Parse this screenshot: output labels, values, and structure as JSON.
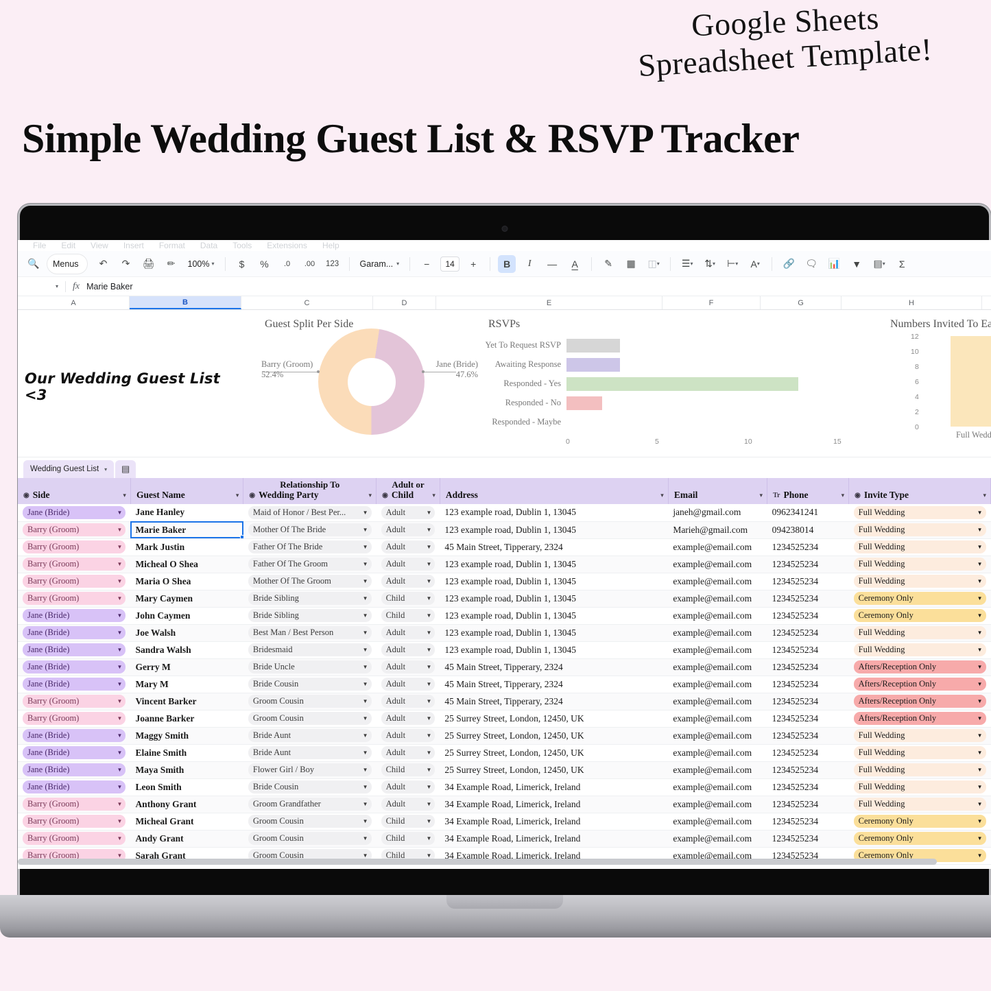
{
  "promo": {
    "badge_line1": "Google Sheets",
    "badge_line2": "Spreadsheet Template!",
    "title": "Simple Wedding Guest List & RSVP Tracker",
    "background_color": "#fbeef5"
  },
  "menubar": [
    "File",
    "Edit",
    "View",
    "Insert",
    "Format",
    "Data",
    "Tools",
    "Extensions",
    "Help"
  ],
  "toolbar": {
    "menus_label": "Menus",
    "search_icon": "search-icon",
    "undo_icon": "undo-icon",
    "redo_icon": "redo-icon",
    "print_icon": "print-icon",
    "paint_format_icon": "paint-format-icon",
    "zoom_value": "100%",
    "currency_label": "$",
    "percent_label": "%",
    "decrease_decimal_label": ".0",
    "increase_decimal_label": ".00",
    "number_format_label": "123",
    "font_name": "Garam...",
    "font_size": "14",
    "decrease_font_label": "−",
    "increase_font_label": "+",
    "bold_label": "B",
    "italic_label": "I",
    "strikethrough_label": "S",
    "text_color_label": "A",
    "fill_color_icon": "fill-color-icon",
    "borders_icon": "borders-icon",
    "merge_icon": "merge-cells-icon",
    "halign_icon": "horizontal-align-icon",
    "valign_icon": "vertical-align-icon",
    "wrap_icon": "text-wrap-icon",
    "rotate_icon": "text-rotation-icon",
    "link_icon": "insert-link-icon",
    "comment_icon": "insert-comment-icon",
    "chart_icon": "insert-chart-icon",
    "filter_icon": "create-filter-icon",
    "functions_icon": "functions-icon",
    "sigma_label": "Σ"
  },
  "formula_bar": {
    "name_box_caret": "name-box-caret",
    "fx_label": "fx",
    "value": "Marie Baker"
  },
  "column_letters": [
    "A",
    "B",
    "C",
    "D",
    "E",
    "F",
    "G",
    "H"
  ],
  "selected_column": "B",
  "sheet_tab": {
    "name": "Wedding Guest List",
    "caret_icon": "chevron-down-icon",
    "all_sheets_icon": "all-sheets-icon"
  },
  "hand_title": "Our Wedding Guest List <3",
  "chart_data": [
    {
      "type": "pie",
      "title": "Guest Split Per Side",
      "labels": [
        "Barry (Groom)",
        "Jane (Bride)"
      ],
      "values": [
        52.4,
        47.6
      ],
      "value_labels": [
        "52.4%",
        "47.6%"
      ],
      "colors": [
        "#fbdcb9",
        "#e3c4d8"
      ],
      "donut": true,
      "legend": "callout-labels"
    },
    {
      "type": "bar",
      "orientation": "horizontal",
      "title": "RSVPs",
      "categories": [
        "Yet To Request RSVP",
        "Awaiting Response",
        "Responded - Yes",
        "Responded - No",
        "Responded - Maybe"
      ],
      "values": [
        3,
        3,
        13,
        2,
        0
      ],
      "colors": [
        "#d6d6d6",
        "#cdc6e8",
        "#cde3c4",
        "#f3bfc0",
        "#ffffff"
      ],
      "xlabel": "",
      "ylabel": "",
      "xlim": [
        0,
        15
      ],
      "xticks": [
        "0",
        "5",
        "10",
        "15"
      ],
      "grid": false
    },
    {
      "type": "bar",
      "orientation": "vertical",
      "title": "Numbers Invited To Each",
      "categories": [
        "Full Wedding"
      ],
      "values": [
        12
      ],
      "colors": [
        "#fbe6bb"
      ],
      "ylim": [
        0,
        12
      ],
      "yticks": [
        "12",
        "10",
        "8",
        "6",
        "4",
        "2",
        "0"
      ],
      "grid": false
    }
  ],
  "table": {
    "columns": [
      {
        "key": "side",
        "sub": "",
        "label": "Side",
        "filter": true
      },
      {
        "key": "guest_name",
        "sub": "",
        "label": "Guest Name",
        "filter": false
      },
      {
        "key": "relationship",
        "sub": "Relationship To",
        "label": "Wedding Party",
        "filter": true
      },
      {
        "key": "adult_child",
        "sub": "Adult or",
        "label": "Child",
        "filter": true
      },
      {
        "key": "address",
        "sub": "",
        "label": "Address",
        "filter": false
      },
      {
        "key": "email",
        "sub": "",
        "label": "Email",
        "filter": false
      },
      {
        "key": "phone",
        "sub": "",
        "label": "Phone",
        "filter": false,
        "type_icon": "Tr"
      },
      {
        "key": "invite_type",
        "sub": "",
        "label": "Invite Type",
        "filter": true
      }
    ],
    "rows": [
      {
        "side": "Jane (Bride)",
        "side_style": "bride",
        "guest_name": "Jane Hanley",
        "relationship": "Maid of Honor / Best Per...",
        "adult_child": "Adult",
        "address": "123 example road, Dublin 1, 13045",
        "email": "janeh@gmail.com",
        "phone": "0962341241",
        "invite_type": "Full Wedding",
        "invite_style": "full"
      },
      {
        "side": "Barry (Groom)",
        "side_style": "groom",
        "guest_name": "Marie Baker",
        "relationship": "Mother Of The Bride",
        "adult_child": "Adult",
        "address": "123 example road, Dublin 1, 13045",
        "email": "Marieh@gmail.com",
        "phone": "094238014",
        "invite_type": "Full Wedding",
        "invite_style": "full",
        "selected": true
      },
      {
        "side": "Barry (Groom)",
        "side_style": "groom",
        "guest_name": "Mark Justin",
        "relationship": "Father Of The Bride",
        "adult_child": "Adult",
        "address": "45 Main Street, Tipperary, 2324",
        "email": "example@email.com",
        "phone": "1234525234",
        "invite_type": "Full Wedding",
        "invite_style": "full"
      },
      {
        "side": "Barry (Groom)",
        "side_style": "groom",
        "guest_name": "Micheal O Shea",
        "relationship": "Father Of The Groom",
        "adult_child": "Adult",
        "address": "123 example road, Dublin 1, 13045",
        "email": "example@email.com",
        "phone": "1234525234",
        "invite_type": "Full Wedding",
        "invite_style": "full"
      },
      {
        "side": "Barry (Groom)",
        "side_style": "groom",
        "guest_name": "Maria O Shea",
        "relationship": "Mother Of The Groom",
        "adult_child": "Adult",
        "address": "123 example road, Dublin 1, 13045",
        "email": "example@email.com",
        "phone": "1234525234",
        "invite_type": "Full Wedding",
        "invite_style": "full"
      },
      {
        "side": "Barry (Groom)",
        "side_style": "groom",
        "guest_name": "Mary Caymen",
        "relationship": "Bride Sibling",
        "adult_child": "Child",
        "address": "123 example road, Dublin 1, 13045",
        "email": "example@email.com",
        "phone": "1234525234",
        "invite_type": "Ceremony Only",
        "invite_style": "ceremony"
      },
      {
        "side": "Jane (Bride)",
        "side_style": "bride",
        "guest_name": "John Caymen",
        "relationship": "Bride Sibling",
        "adult_child": "Child",
        "address": "123 example road, Dublin 1, 13045",
        "email": "example@email.com",
        "phone": "1234525234",
        "invite_type": "Ceremony Only",
        "invite_style": "ceremony"
      },
      {
        "side": "Jane (Bride)",
        "side_style": "bride",
        "guest_name": "Joe Walsh",
        "relationship": "Best Man / Best Person",
        "adult_child": "Adult",
        "address": "123 example road, Dublin 1, 13045",
        "email": "example@email.com",
        "phone": "1234525234",
        "invite_type": "Full Wedding",
        "invite_style": "full"
      },
      {
        "side": "Jane (Bride)",
        "side_style": "bride",
        "guest_name": "Sandra Walsh",
        "relationship": "Bridesmaid",
        "adult_child": "Adult",
        "address": "123 example road, Dublin 1, 13045",
        "email": "example@email.com",
        "phone": "1234525234",
        "invite_type": "Full Wedding",
        "invite_style": "full"
      },
      {
        "side": "Jane (Bride)",
        "side_style": "bride",
        "guest_name": "Gerry M",
        "relationship": "Bride Uncle",
        "adult_child": "Adult",
        "address": "45 Main Street, Tipperary, 2324",
        "email": "example@email.com",
        "phone": "1234525234",
        "invite_type": "Afters/Reception Only",
        "invite_style": "afters"
      },
      {
        "side": "Jane (Bride)",
        "side_style": "bride",
        "guest_name": "Mary M",
        "relationship": "Bride Cousin",
        "adult_child": "Adult",
        "address": "45 Main Street, Tipperary, 2324",
        "email": "example@email.com",
        "phone": "1234525234",
        "invite_type": "Afters/Reception Only",
        "invite_style": "afters"
      },
      {
        "side": "Barry (Groom)",
        "side_style": "groom",
        "guest_name": "Vincent Barker",
        "relationship": "Groom Cousin",
        "adult_child": "Adult",
        "address": "45 Main Street, Tipperary, 2324",
        "email": "example@email.com",
        "phone": "1234525234",
        "invite_type": "Afters/Reception Only",
        "invite_style": "afters"
      },
      {
        "side": "Barry (Groom)",
        "side_style": "groom",
        "guest_name": "Joanne Barker",
        "relationship": "Groom Cousin",
        "adult_child": "Adult",
        "address": "25 Surrey Street, London, 12450, UK",
        "email": "example@email.com",
        "phone": "1234525234",
        "invite_type": "Afters/Reception Only",
        "invite_style": "afters"
      },
      {
        "side": "Jane (Bride)",
        "side_style": "bride",
        "guest_name": "Maggy Smith",
        "relationship": "Bride Aunt",
        "adult_child": "Adult",
        "address": "25 Surrey Street, London, 12450, UK",
        "email": "example@email.com",
        "phone": "1234525234",
        "invite_type": "Full Wedding",
        "invite_style": "full"
      },
      {
        "side": "Jane (Bride)",
        "side_style": "bride",
        "guest_name": "Elaine Smith",
        "relationship": "Bride Aunt",
        "adult_child": "Adult",
        "address": "25 Surrey Street, London, 12450, UK",
        "email": "example@email.com",
        "phone": "1234525234",
        "invite_type": "Full Wedding",
        "invite_style": "full"
      },
      {
        "side": "Jane (Bride)",
        "side_style": "bride",
        "guest_name": "Maya Smith",
        "relationship": "Flower Girl / Boy",
        "adult_child": "Child",
        "address": "25 Surrey Street, London, 12450, UK",
        "email": "example@email.com",
        "phone": "1234525234",
        "invite_type": "Full Wedding",
        "invite_style": "full"
      },
      {
        "side": "Jane (Bride)",
        "side_style": "bride",
        "guest_name": "Leon Smith",
        "relationship": "Bride Cousin",
        "adult_child": "Adult",
        "address": "34 Example Road, Limerick, Ireland",
        "email": "example@email.com",
        "phone": "1234525234",
        "invite_type": "Full Wedding",
        "invite_style": "full"
      },
      {
        "side": "Barry (Groom)",
        "side_style": "groom",
        "guest_name": "Anthony Grant",
        "relationship": "Groom Grandfather",
        "adult_child": "Adult",
        "address": "34 Example Road, Limerick, Ireland",
        "email": "example@email.com",
        "phone": "1234525234",
        "invite_type": "Full Wedding",
        "invite_style": "full"
      },
      {
        "side": "Barry (Groom)",
        "side_style": "groom",
        "guest_name": "Micheal Grant",
        "relationship": "Groom Cousin",
        "adult_child": "Child",
        "address": "34 Example Road, Limerick, Ireland",
        "email": "example@email.com",
        "phone": "1234525234",
        "invite_type": "Ceremony Only",
        "invite_style": "ceremony"
      },
      {
        "side": "Barry (Groom)",
        "side_style": "groom",
        "guest_name": "Andy Grant",
        "relationship": "Groom Cousin",
        "adult_child": "Child",
        "address": "34 Example Road, Limerick, Ireland",
        "email": "example@email.com",
        "phone": "1234525234",
        "invite_type": "Ceremony Only",
        "invite_style": "ceremony"
      },
      {
        "side": "Barry (Groom)",
        "side_style": "groom",
        "guest_name": "Sarah Grant",
        "relationship": "Groom Cousin",
        "adult_child": "Child",
        "address": "34 Example Road, Limerick, Ireland",
        "email": "example@email.com",
        "phone": "1234525234",
        "invite_type": "Ceremony Only",
        "invite_style": "ceremony"
      }
    ]
  }
}
